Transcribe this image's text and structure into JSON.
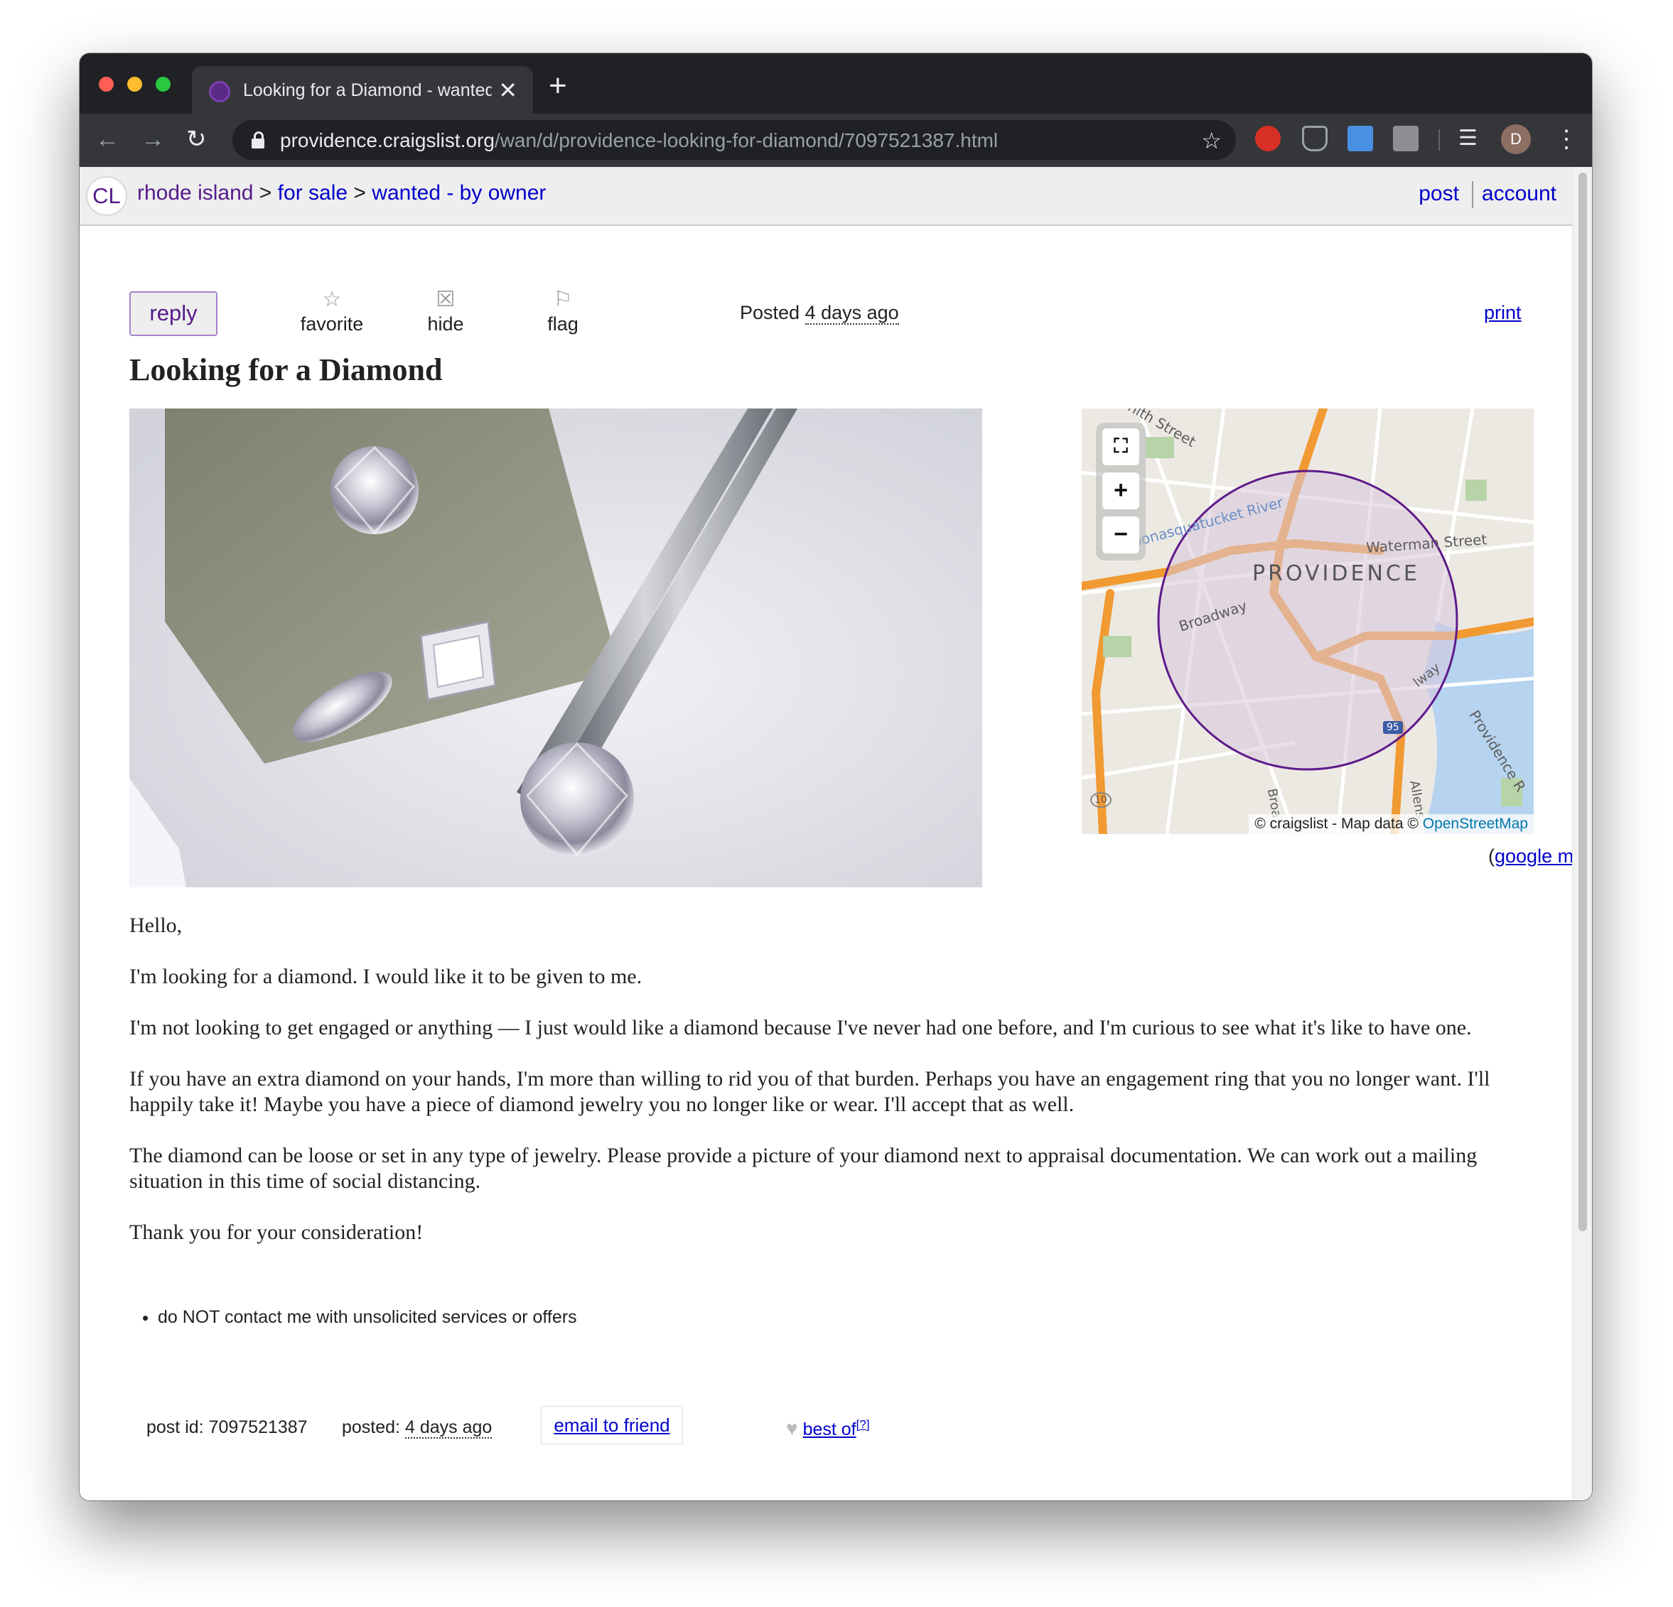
{
  "browser": {
    "tab_title": "Looking for a Diamond - wanted",
    "new_tab_label": "+",
    "close_tab_label": "✕",
    "url_host": "providence.craigslist.org",
    "url_path": "/wan/d/providence-looking-for-diamond/7097521387.html",
    "profile_initial": "D"
  },
  "header": {
    "logo_text": "CL",
    "breadcrumbs": [
      {
        "label": "rhode island"
      },
      {
        "label": "for sale"
      },
      {
        "label": "wanted - by owner"
      }
    ],
    "separator": ">",
    "post_label": "post",
    "account_label": "account"
  },
  "actions": {
    "reply_label": "reply",
    "favorite_label": "favorite",
    "hide_label": "hide",
    "flag_label": "flag",
    "posted_prefix": "Posted",
    "posted_ago": "4 days ago",
    "print_label": "print"
  },
  "posting": {
    "title": "Looking for a Diamond",
    "body": [
      "Hello,",
      "I'm looking for a diamond. I would like it to be given to me.",
      "I'm not looking to get engaged or anything — I just would like a diamond because I've never had one before, and I'm curious to see what it's like to have one.",
      "If you have an extra diamond on your hands, I'm more than willing to rid you of that burden. Perhaps you have an engagement ring that you no longer want. I'll happily take it! Maybe you have a piece of diamond jewelry you no longer like or wear. I'll accept that as well.",
      "The diamond can be loose or set in any type of jewelry. Please provide a picture of your diamond next to appraisal documentation. We can work out a mailing situation in this time of social distancing.",
      "Thank you for your consideration!"
    ],
    "notices": [
      "do NOT contact me with unsolicited services or offers"
    ]
  },
  "map": {
    "city_label": "PROVIDENCE",
    "street_labels": [
      "Waterman Street",
      "Broadway",
      "Woonasquatucket River",
      "nith Street",
      "Providence R",
      "Allens",
      "Broa",
      "lway"
    ],
    "highway_shields": [
      "95",
      "10"
    ],
    "zoom_in": "+",
    "zoom_out": "−",
    "fullscreen": "⛶",
    "attribution_prefix": "© craigslist - Map data ©",
    "attribution_link": "OpenStreetMap",
    "google_map_label": "google map",
    "paren_open": "(",
    "paren_close": ")",
    "colors": {
      "area_fill": "#d9c6dc",
      "circle_stroke": "#5e1a8a",
      "highway": "#f19a32",
      "water": "#b6d3ef"
    }
  },
  "footer": {
    "post_id_label": "post id: 7097521387",
    "posted_label": "posted:",
    "posted_ago": "4 days ago",
    "email_label": "email to friend",
    "best_of_label": "best of",
    "help_mark": "[?]"
  }
}
